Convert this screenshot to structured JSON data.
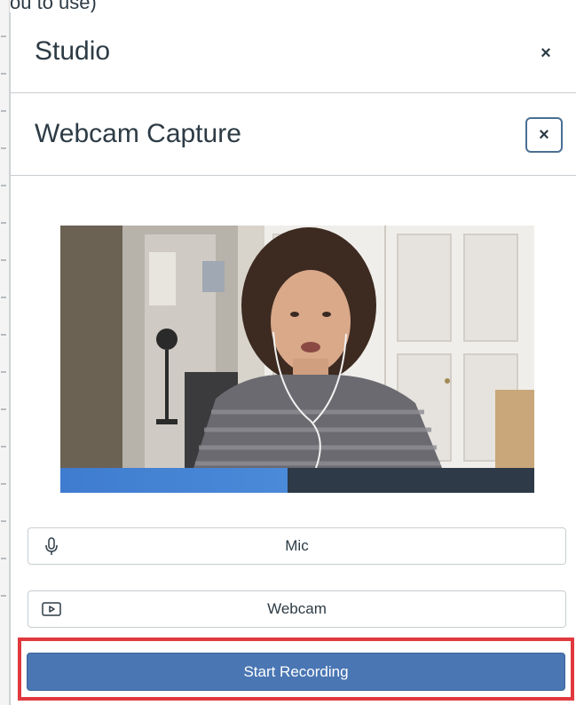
{
  "background": {
    "partial_text": "you to use)"
  },
  "tray": {
    "title": "Studio",
    "close_label": "×"
  },
  "capture": {
    "title": "Webcam Capture",
    "close_label": "×"
  },
  "preview": {
    "audio_level": 0.48
  },
  "devices": {
    "mic_label": "Mic",
    "webcam_label": "Webcam"
  },
  "actions": {
    "start_label": "Start Recording"
  },
  "colors": {
    "primary_button": "#4a76b3",
    "highlight": "#e0393e",
    "level_fill": "#3f7cd0",
    "text": "#2d3b45"
  },
  "icons": {
    "mic": "microphone-icon",
    "webcam": "video-play-icon"
  }
}
